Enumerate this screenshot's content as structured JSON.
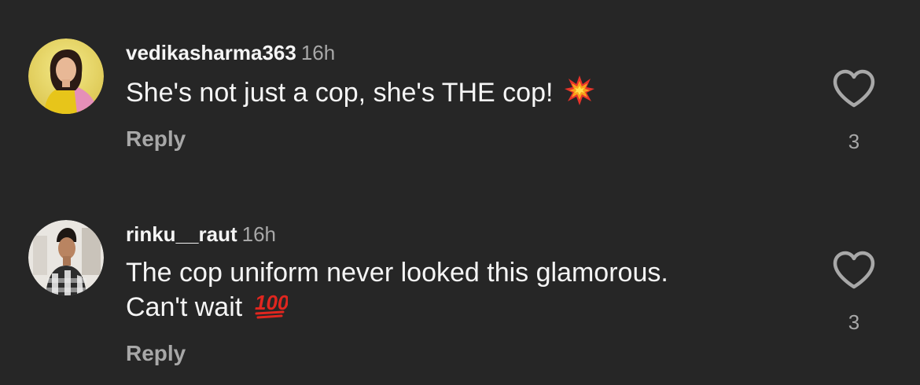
{
  "comments": [
    {
      "username": "vedikasharma363",
      "time": "16h",
      "text": "She's not just a cop, she's THE cop!",
      "emoji": "collision-icon",
      "reply_label": "Reply",
      "likes": "3"
    },
    {
      "username": "rinku__raut",
      "time": "16h",
      "text": "The cop uniform never looked this glamorous.\nCan't wait",
      "emoji": "hundred-points-icon",
      "reply_label": "Reply",
      "likes": "3"
    }
  ],
  "colors": {
    "background": "#262626",
    "primary_text": "#f5f5f5",
    "secondary_text": "#a8a8a8"
  }
}
